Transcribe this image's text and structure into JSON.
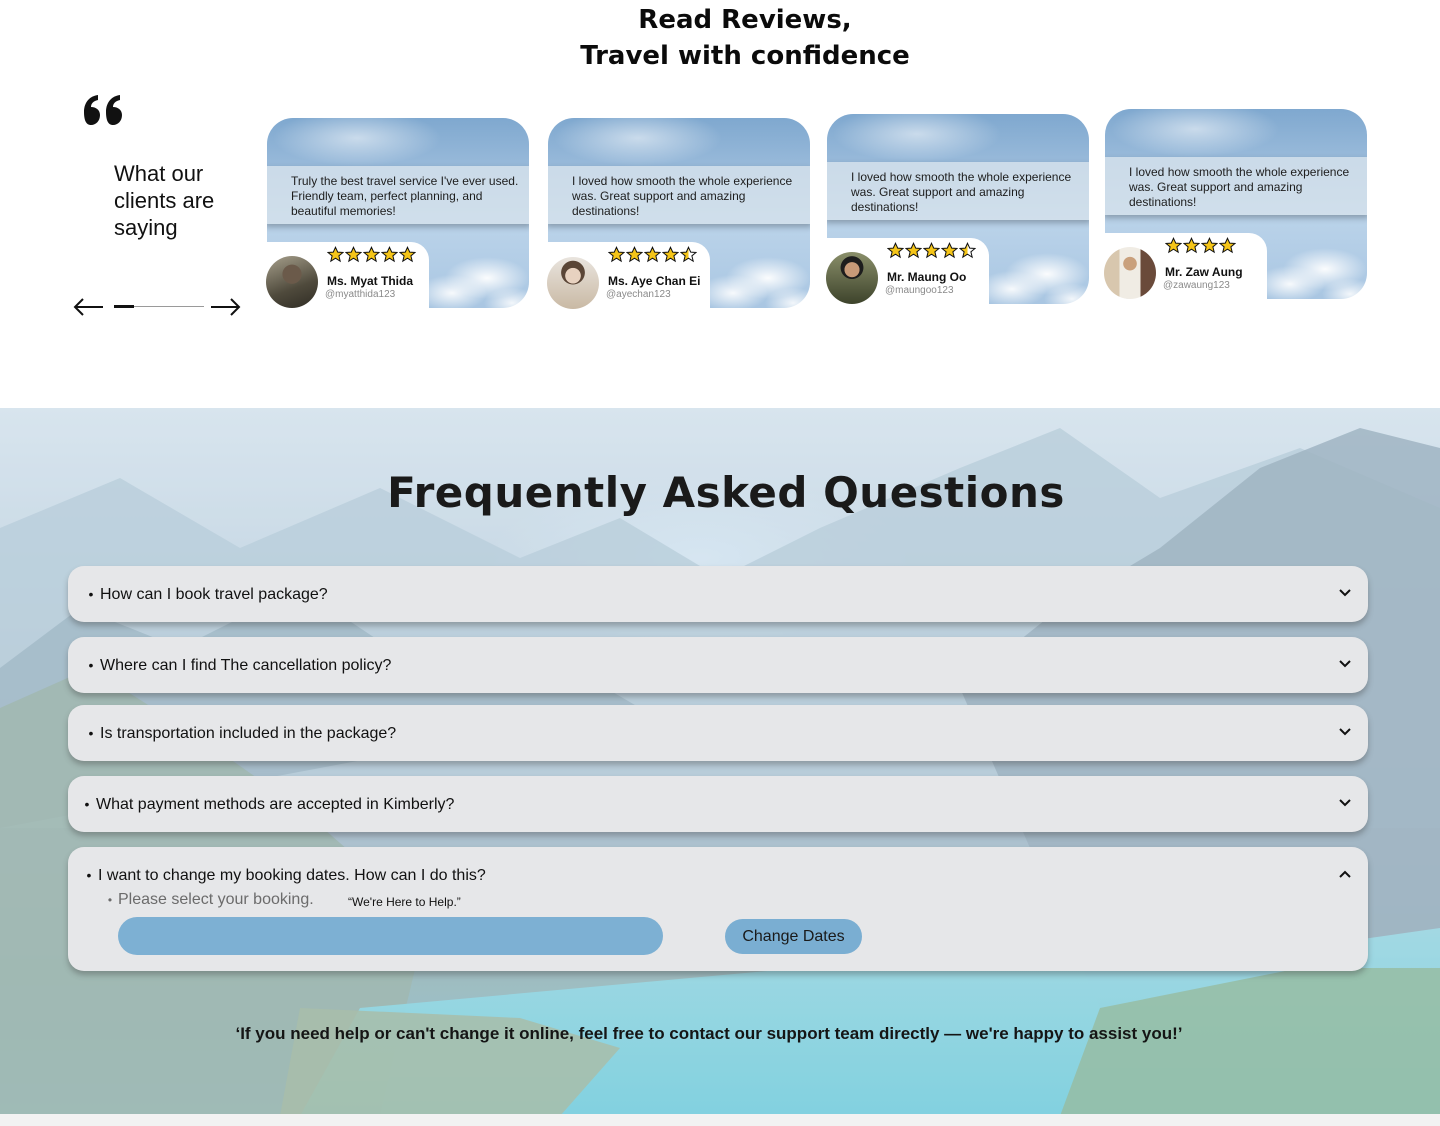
{
  "reviews": {
    "title_line1": "Read Reviews,",
    "title_line2": "Travel with confidence",
    "section_heading": "What our clients are saying",
    "cards": [
      {
        "text": "Truly the best travel service I've ever used. Friendly team, perfect planning, and beautiful memories!",
        "rating": 5,
        "name": "Ms. Myat Thida",
        "handle": "@myatthida123"
      },
      {
        "text": "I loved how smooth the whole experience was. Great support and amazing destinations!",
        "rating": 4.5,
        "name": "Ms. Aye Chan Ei",
        "handle": "@ayechan123"
      },
      {
        "text": "I loved how smooth the whole experience was. Great support and amazing destinations!",
        "rating": 4.5,
        "name": "Mr. Maung Oo",
        "handle": "@maungoo123"
      },
      {
        "text": "I loved how smooth the whole experience was. Great support and amazing destinations!",
        "rating": 4,
        "name": "Mr. Zaw Aung",
        "handle": "@zawaung123"
      }
    ]
  },
  "faq": {
    "title": "Frequently Asked Questions",
    "items": [
      {
        "question": "How can I book travel package?",
        "open": false
      },
      {
        "question": "Where can I find The cancellation policy?",
        "open": false
      },
      {
        "question": "Is transportation included in the package?",
        "open": false
      },
      {
        "question": "What payment methods are accepted in Kimberly?",
        "open": false
      },
      {
        "question": "I want to change my booking dates. How can I do this?",
        "open": true
      }
    ],
    "answer": {
      "sub_text": "Please select your booking.",
      "help_note": "“We're Here to Help.”",
      "booking_value": "",
      "button_label": "Change Dates"
    },
    "support_note": "‘If you need help or can't change it online, feel free to contact our support team directly — we're happy to assist you!’"
  },
  "colors": {
    "accent_blue": "#7db0d3",
    "star_fill": "#f5c518"
  }
}
